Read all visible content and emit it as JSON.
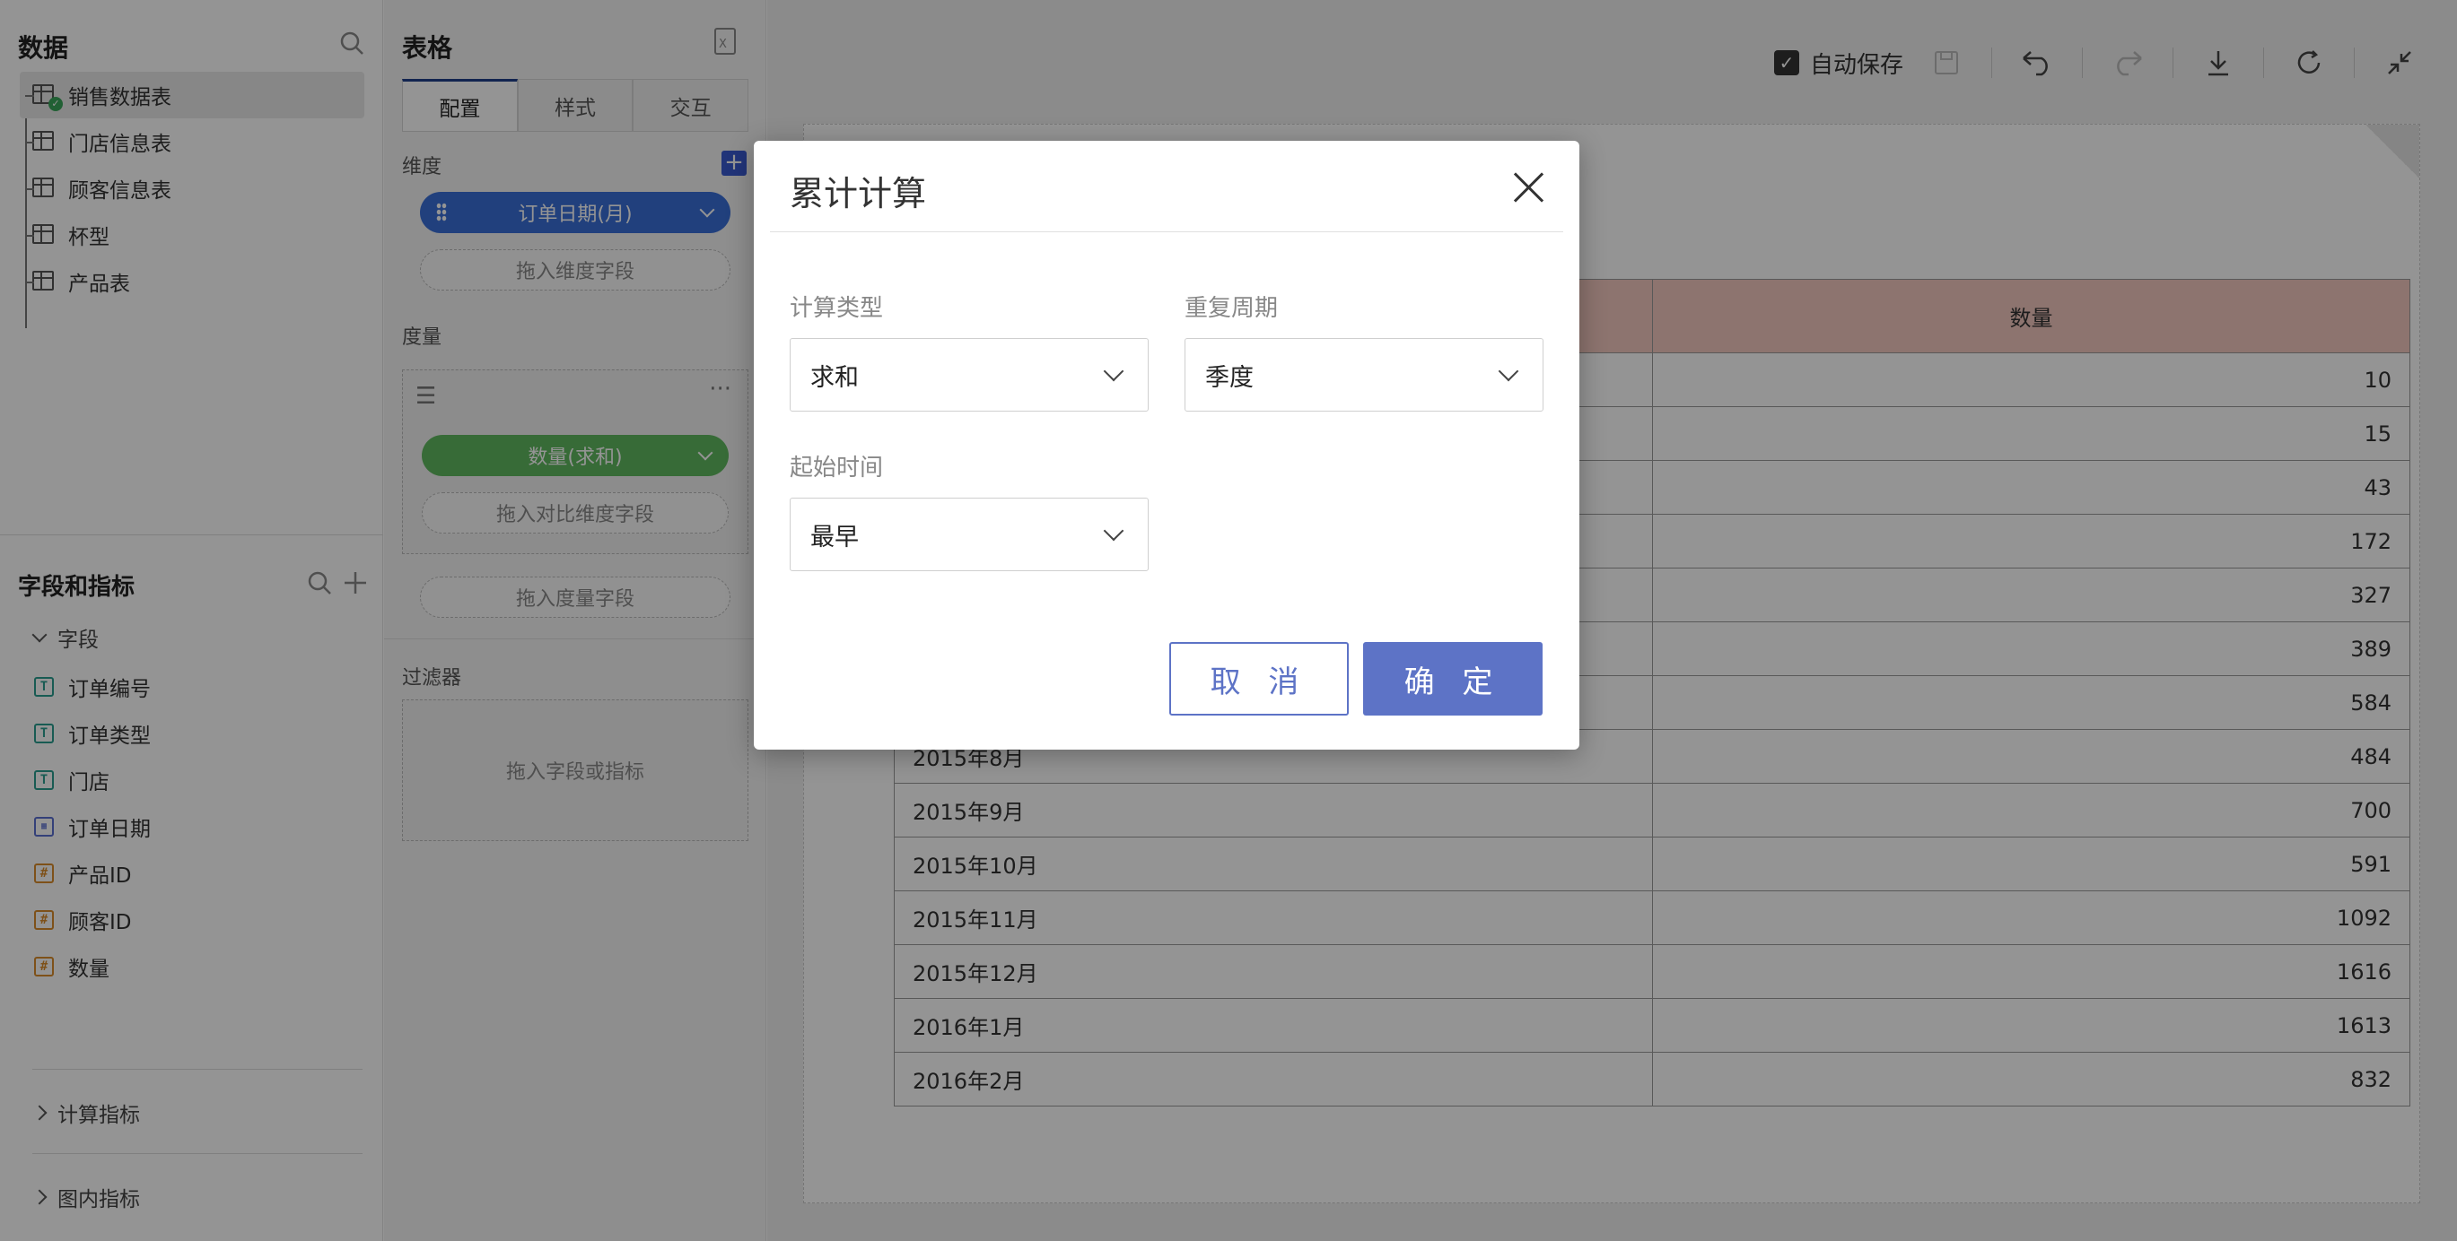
{
  "data_panel": {
    "title": "数据",
    "tables": [
      "销售数据表",
      "门店信息表",
      "顾客信息表",
      "杯型",
      "产品表"
    ],
    "fields_title": "字段和指标",
    "fields_group": "字段",
    "fields": [
      {
        "type": "text",
        "icon_glyph": "T",
        "label": "订单编号"
      },
      {
        "type": "text",
        "icon_glyph": "T",
        "label": "订单类型"
      },
      {
        "type": "text",
        "icon_glyph": "T",
        "label": "门店"
      },
      {
        "type": "date",
        "icon_glyph": "▦",
        "label": "订单日期"
      },
      {
        "type": "number",
        "icon_glyph": "#",
        "label": "产品ID"
      },
      {
        "type": "number",
        "icon_glyph": "#",
        "label": "顾客ID"
      },
      {
        "type": "number",
        "icon_glyph": "#",
        "label": "数量"
      }
    ],
    "calc_metrics": "计算指标",
    "chart_metrics": "图内指标"
  },
  "config_panel": {
    "title": "表格",
    "tabs": [
      "配置",
      "样式",
      "交互"
    ],
    "dimension_label": "维度",
    "dimension_pill": "订单日期(月)",
    "dimension_drop": "拖入维度字段",
    "measure_label": "度量",
    "measure_pill": "数量(求和)",
    "compare_drop": "拖入对比维度字段",
    "measure_drop": "拖入度量字段",
    "filter_label": "过滤器",
    "filter_drop": "拖入字段或指标"
  },
  "toolbar": {
    "autosave_label": "自动保存",
    "autosave_checked": true
  },
  "table": {
    "col2_header": "数量",
    "rows": [
      {
        "label": "",
        "value": "10"
      },
      {
        "label": "",
        "value": "15"
      },
      {
        "label": "",
        "value": "43"
      },
      {
        "label": "",
        "value": "172"
      },
      {
        "label": "",
        "value": "327"
      },
      {
        "label": "",
        "value": "389"
      },
      {
        "label": "",
        "value": "584"
      },
      {
        "label": "2015年8月",
        "value": "484"
      },
      {
        "label": "2015年9月",
        "value": "700"
      },
      {
        "label": "2015年10月",
        "value": "591"
      },
      {
        "label": "2015年11月",
        "value": "1092"
      },
      {
        "label": "2015年12月",
        "value": "1616"
      },
      {
        "label": "2016年1月",
        "value": "1613"
      },
      {
        "label": "2016年2月",
        "value": "832"
      }
    ]
  },
  "modal": {
    "title": "累计计算",
    "calc_type_label": "计算类型",
    "calc_type_value": "求和",
    "repeat_label": "重复周期",
    "repeat_value": "季度",
    "start_label": "起始时间",
    "start_value": "最早",
    "cancel": "取 消",
    "ok": "确 定"
  },
  "colors": {
    "primary": "#5d73c6",
    "dimension_pill": "#3a6fd8",
    "measure_pill": "#5fb85f",
    "table_header": "#f3c9bf"
  }
}
